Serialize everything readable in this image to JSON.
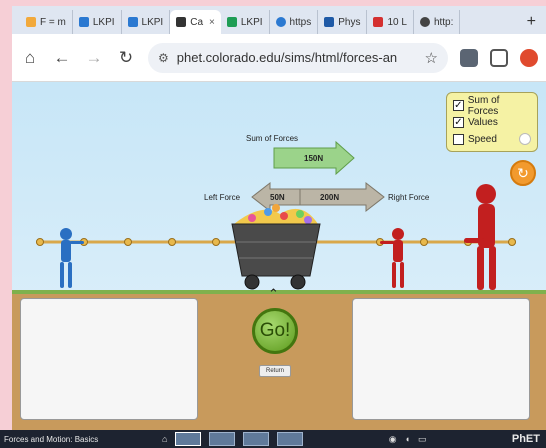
{
  "browser": {
    "tabs": [
      {
        "label": "F = m",
        "fav_color": "#f2a93b",
        "active": false
      },
      {
        "label": "LKPI",
        "fav_color": "#2b79d1",
        "active": false
      },
      {
        "label": "LKPI",
        "fav_color": "#2b79d1",
        "active": false
      },
      {
        "label": "Ca",
        "fav_color": "#333333",
        "active": true
      },
      {
        "label": "LKPI",
        "fav_color": "#1f9d55",
        "active": false
      },
      {
        "label": "https",
        "fav_color": "#2b79d1",
        "active": false
      },
      {
        "label": "Phys",
        "fav_color": "#1f5aa6",
        "active": false
      },
      {
        "label": "10 L",
        "fav_color": "#d43030",
        "active": false
      },
      {
        "label": "http:",
        "fav_color": "#444444",
        "active": false
      }
    ],
    "close_glyph": "×",
    "new_tab_glyph": "+",
    "url": "phet.colorado.edu/sims/html/forces-an"
  },
  "sim": {
    "controls": {
      "sum_of_forces": {
        "label": "Sum of Forces",
        "checked": true
      },
      "values": {
        "label": "Values",
        "checked": true
      },
      "speed": {
        "label": "Speed",
        "checked": false
      }
    },
    "sum_label": "Sum of Forces",
    "sum_value": "150N",
    "left_force_label": "Left Force",
    "left_value": "50N",
    "right_value": "200N",
    "right_force_label": "Right Force",
    "go_label": "Go!",
    "return_label": "Return"
  },
  "taskbar": {
    "title": "Forces and Motion: Basics",
    "logo": "PhET"
  },
  "colors": {
    "sky_top": "#c7e6f7",
    "ground": "#c89a5c",
    "blue_puller": "#2a6fc2",
    "red_puller": "#c21f1f",
    "arrow_green": "#9bd38a",
    "arrow_gray": "#bbb5a6",
    "go_green": "#7cbd3a"
  }
}
